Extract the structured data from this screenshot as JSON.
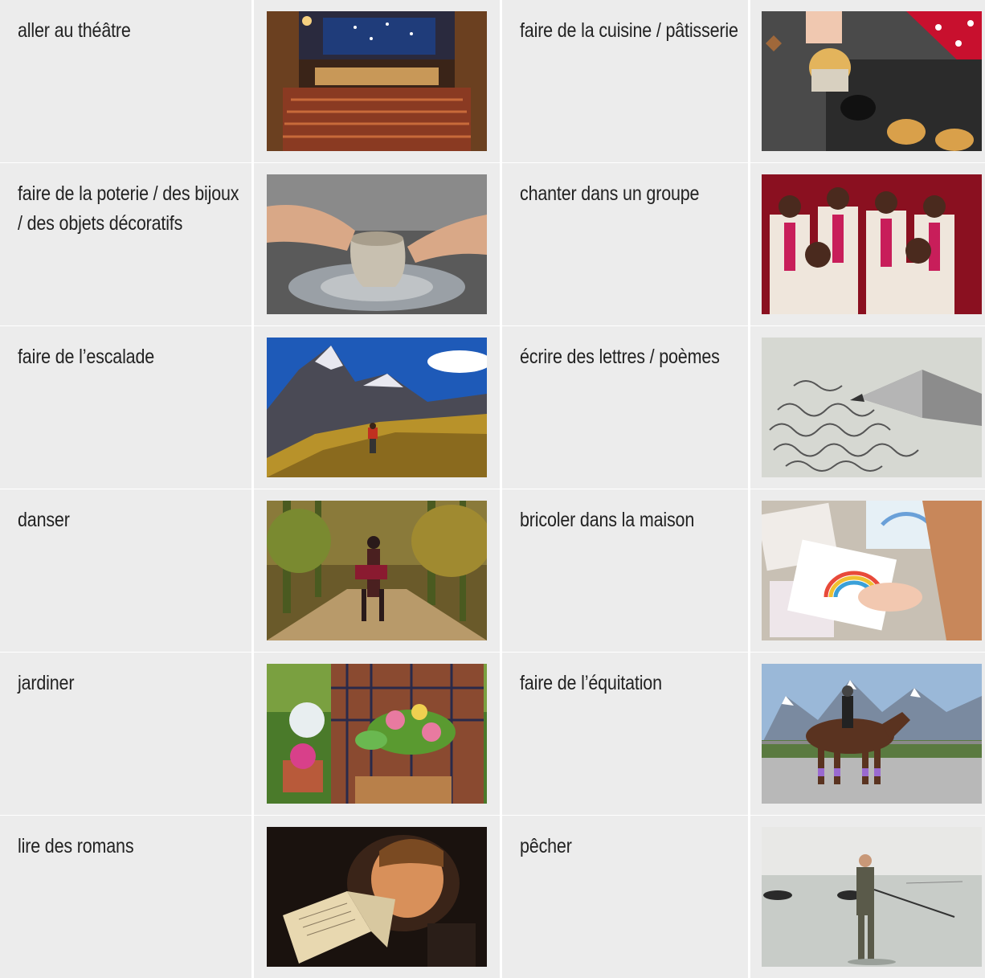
{
  "activities": [
    {
      "label": "aller au théâtre",
      "image": "theatre-auditorium"
    },
    {
      "label": "faire de la cuisine / pâtisserie",
      "image": "baking-muffins"
    },
    {
      "label": "faire de la poterie / des bijoux / des objets décoratifs",
      "image": "pottery-wheel"
    },
    {
      "label": "chanter dans un groupe",
      "image": "gospel-choir"
    },
    {
      "label": "faire de l’escalade",
      "image": "mountain-hiker"
    },
    {
      "label": "écrire des lettres / poèmes",
      "image": "fountain-pen-letter"
    },
    {
      "label": "danser",
      "image": "couple-dancing-forest"
    },
    {
      "label": "bricoler dans la maison",
      "image": "crafting-paper"
    },
    {
      "label": "jardiner",
      "image": "gardener-flowers"
    },
    {
      "label": "faire de l’équitation",
      "image": "horse-rider"
    },
    {
      "label": "lire des romans",
      "image": "child-reading-book"
    },
    {
      "label": "pêcher",
      "image": "fisherman-sea"
    }
  ]
}
